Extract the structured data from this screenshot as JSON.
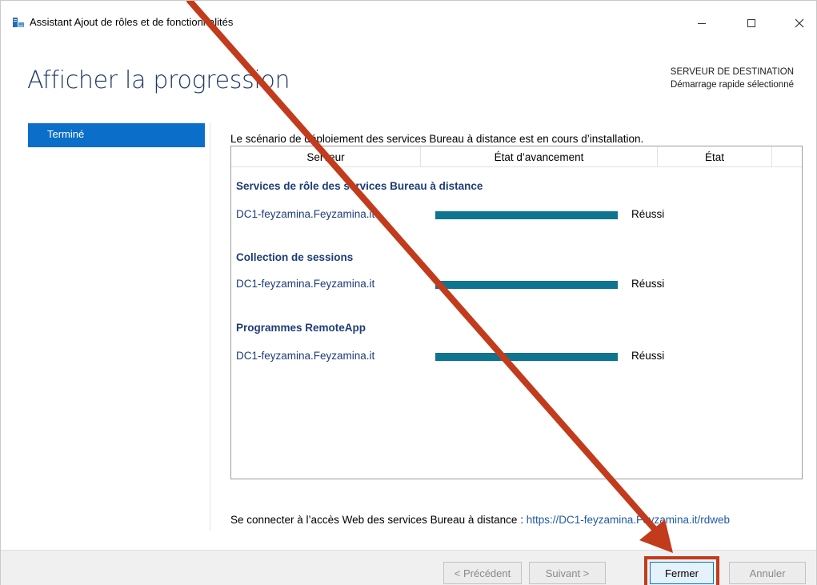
{
  "window": {
    "title": "Assistant Ajout de rôles et de fonctionnalités"
  },
  "page": {
    "title": "Afficher la progression",
    "destination_label": "SERVEUR DE DESTINATION",
    "destination_value": "Démarrage rapide sélectionné"
  },
  "nav": {
    "items": [
      {
        "label": "Terminé"
      }
    ]
  },
  "main": {
    "intro": "Le scénario de déploiement des services Bureau à distance est en cours d’installation.",
    "columns": [
      "Serveur",
      "État d’avancement",
      "État"
    ],
    "groups": [
      {
        "title": "Services de rôle des services Bureau à distance",
        "server": "DC1-feyzamina.Feyzamina.it",
        "progress": 100,
        "status": "Réussi"
      },
      {
        "title": "Collection de sessions",
        "server": "DC1-feyzamina.Feyzamina.it",
        "progress": 100,
        "status": "Réussi"
      },
      {
        "title": "Programmes RemoteApp",
        "server": "DC1-feyzamina.Feyzamina.it",
        "progress": 100,
        "status": "Réussi"
      }
    ],
    "web_access_label": "Se connecter à l’accès Web des services Bureau à distance : ",
    "web_access_url": "https://DC1-feyzamina.Feyzamina.it/rdweb"
  },
  "buttons": {
    "prev": "< Précédent",
    "next": "Suivant >",
    "close": "Fermer",
    "cancel": "Annuler"
  },
  "colors": {
    "accent": "#0b6ec8",
    "progress": "#0e7490",
    "annotation": "#c23b1c"
  }
}
